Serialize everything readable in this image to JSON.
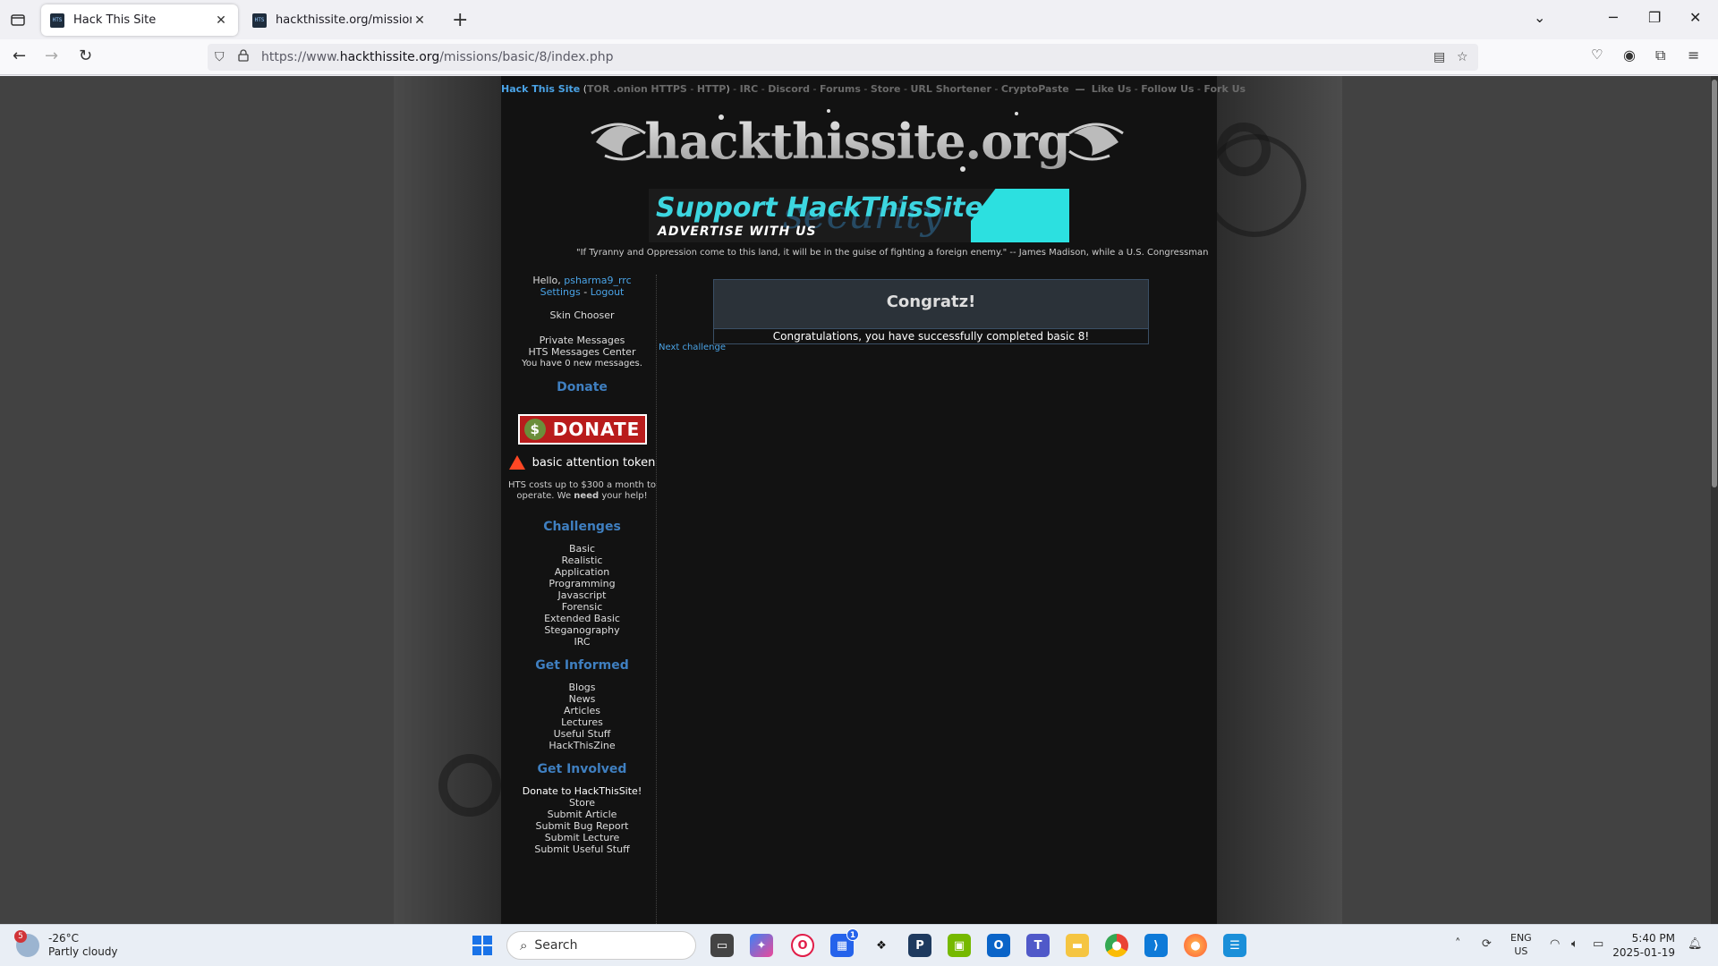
{
  "browser": {
    "tabs": [
      {
        "title": "Hack This Site",
        "active": true
      },
      {
        "title": "hackthissite.org/missions/basic",
        "active": false
      }
    ],
    "url_prefix": "https://www.",
    "url_domain": "hackthissite.org",
    "url_path": "/missions/basic/8/index.php"
  },
  "header": {
    "site_link": "Hack This Site",
    "links": [
      "TOR .onion",
      "HTTPS",
      "HTTP",
      "IRC",
      "Discord",
      "Forums",
      "Store",
      "URL Shortener",
      "CryptoPaste"
    ],
    "social": [
      "Like Us",
      "Follow Us",
      "Fork Us"
    ],
    "logo_text": "hackthissite.org"
  },
  "banner": {
    "title": "Support HackThisSite",
    "subtitle": "ADVERTISE WITH US",
    "ghost_text": "security"
  },
  "quote": "\"If Tyranny and Oppression come to this land, it will be in the guise of fighting a foreign enemy.\" -- James Madison, while a U.S. Congressman",
  "sidebar": {
    "hello": "Hello,",
    "username": "psharma9_rrc",
    "settings": "Settings",
    "logout": "Logout",
    "skin_chooser": "Skin Chooser",
    "private_messages": "Private Messages",
    "messages_center": "HTS Messages Center",
    "new_messages": "You have 0 new messages.",
    "donate_heading": "Donate",
    "donate_button": "DONATE",
    "bat_label": "basic attention token",
    "cost_note_1": "HTS costs up to $300 a month to",
    "cost_note_2": "operate. We",
    "cost_note_bold": "need",
    "cost_note_3": "your help!",
    "challenges_heading": "Challenges",
    "challenges": [
      "Basic",
      "Realistic",
      "Application",
      "Programming",
      "Javascript",
      "Forensic",
      "Extended Basic",
      "Steganography",
      "IRC"
    ],
    "informed_heading": "Get Informed",
    "informed": [
      "Blogs",
      "News",
      "Articles",
      "Lectures",
      "Useful Stuff",
      "HackThisZine"
    ],
    "involved_heading": "Get Involved",
    "involved": [
      "Donate to HackThisSite!",
      "Store",
      "Submit Article",
      "Submit Bug Report",
      "Submit Lecture",
      "Submit Useful Stuff"
    ]
  },
  "main": {
    "congrats_title": "Congratz!",
    "congrats_message": "Congratulations, you have successfully completed basic 8!",
    "next_challenge": "Next challenge"
  },
  "taskbar": {
    "weather_temp": "-26°C",
    "weather_desc": "Partly cloudy",
    "weather_badge": "5",
    "search_placeholder": "Search",
    "store_badge": "1",
    "lang_1": "ENG",
    "lang_2": "US",
    "time": "5:40 PM",
    "date": "2025-01-19"
  },
  "colors": {
    "link_blue": "#4aa3e6",
    "heading_blue": "#3f7fc0",
    "banner_cyan": "#3cd6e0",
    "donate_red": "#b91c1c"
  }
}
